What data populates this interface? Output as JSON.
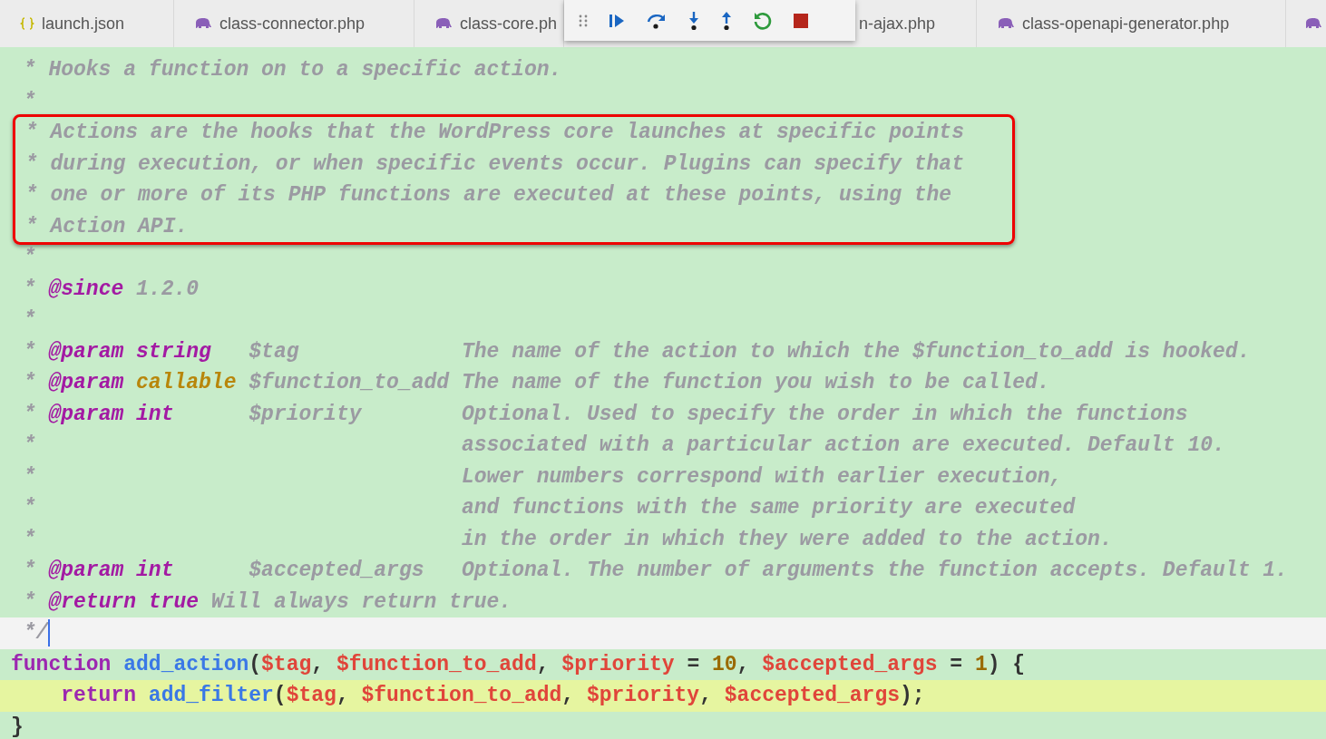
{
  "tabs": [
    {
      "label": "launch.json"
    },
    {
      "label": "class-connector.php"
    },
    {
      "label": "class-core.ph"
    },
    {
      "label": "n-ajax.php"
    },
    {
      "label": "class-openapi-generator.php"
    }
  ],
  "lines": [
    {
      "boxed": false,
      "current": false,
      "paused": false,
      "tokens": [
        {
          "kind": "comment",
          "text": " * Hooks a function on to a specific action."
        }
      ]
    },
    {
      "boxed": false,
      "current": false,
      "paused": false,
      "tokens": [
        {
          "kind": "comment",
          "text": " *"
        }
      ]
    },
    {
      "boxed": true,
      "current": false,
      "paused": false,
      "tokens": [
        {
          "kind": "comment",
          "text": " * Actions are the hooks that the WordPress core launches at specific points"
        }
      ]
    },
    {
      "boxed": true,
      "current": false,
      "paused": false,
      "tokens": [
        {
          "kind": "comment",
          "text": " * during execution, or when specific events occur. Plugins can specify that"
        }
      ]
    },
    {
      "boxed": true,
      "current": false,
      "paused": false,
      "tokens": [
        {
          "kind": "comment",
          "text": " * one or more of its PHP functions are executed at these points, using the"
        }
      ]
    },
    {
      "boxed": true,
      "current": false,
      "paused": false,
      "tokens": [
        {
          "kind": "comment",
          "text": " * Action API."
        }
      ]
    },
    {
      "boxed": false,
      "current": false,
      "paused": false,
      "tokens": [
        {
          "kind": "comment",
          "text": " *"
        }
      ]
    },
    {
      "boxed": false,
      "current": false,
      "paused": false,
      "tokens": [
        {
          "kind": "comment",
          "text": " * "
        },
        {
          "kind": "tag",
          "text": "@since"
        },
        {
          "kind": "comment",
          "text": " 1.2.0"
        }
      ]
    },
    {
      "boxed": false,
      "current": false,
      "paused": false,
      "tokens": [
        {
          "kind": "comment",
          "text": " *"
        }
      ]
    },
    {
      "boxed": false,
      "current": false,
      "paused": false,
      "tokens": [
        {
          "kind": "comment",
          "text": " * "
        },
        {
          "kind": "tag",
          "text": "@param"
        },
        {
          "kind": "tag",
          "text": " string"
        },
        {
          "kind": "comment",
          "text": "   $tag             The name of the action to which the $function_to_add is hooked."
        }
      ]
    },
    {
      "boxed": false,
      "current": false,
      "paused": false,
      "tokens": [
        {
          "kind": "comment",
          "text": " * "
        },
        {
          "kind": "tag",
          "text": "@param"
        },
        {
          "kind": "type",
          "text": " callable"
        },
        {
          "kind": "comment",
          "text": " $function_to_add The name of the function you wish to be called."
        }
      ]
    },
    {
      "boxed": false,
      "current": false,
      "paused": false,
      "tokens": [
        {
          "kind": "comment",
          "text": " * "
        },
        {
          "kind": "tag",
          "text": "@param"
        },
        {
          "kind": "tag",
          "text": " int"
        },
        {
          "kind": "comment",
          "text": "      $priority        Optional. Used to specify the order in which the functions"
        }
      ]
    },
    {
      "boxed": false,
      "current": false,
      "paused": false,
      "tokens": [
        {
          "kind": "comment",
          "text": " *                                  associated with a particular action are executed. Default 10."
        }
      ]
    },
    {
      "boxed": false,
      "current": false,
      "paused": false,
      "tokens": [
        {
          "kind": "comment",
          "text": " *                                  Lower numbers correspond with earlier execution,"
        }
      ]
    },
    {
      "boxed": false,
      "current": false,
      "paused": false,
      "tokens": [
        {
          "kind": "comment",
          "text": " *                                  and functions with the same priority are executed"
        }
      ]
    },
    {
      "boxed": false,
      "current": false,
      "paused": false,
      "tokens": [
        {
          "kind": "comment",
          "text": " *                                  in the order in which they were added to the action."
        }
      ]
    },
    {
      "boxed": false,
      "current": false,
      "paused": false,
      "tokens": [
        {
          "kind": "comment",
          "text": " * "
        },
        {
          "kind": "tag",
          "text": "@param"
        },
        {
          "kind": "tag",
          "text": " int"
        },
        {
          "kind": "comment",
          "text": "      $accepted_args   Optional. The number of arguments the function accepts. Default 1."
        }
      ]
    },
    {
      "boxed": false,
      "current": false,
      "paused": false,
      "tokens": [
        {
          "kind": "comment",
          "text": " * "
        },
        {
          "kind": "tag",
          "text": "@return"
        },
        {
          "kind": "tag",
          "text": " true"
        },
        {
          "kind": "comment",
          "text": " Will always return true."
        }
      ]
    },
    {
      "boxed": false,
      "current": true,
      "paused": false,
      "tokens": [
        {
          "kind": "comment",
          "text": " */"
        }
      ]
    },
    {
      "boxed": false,
      "current": false,
      "paused": false,
      "tokens": [
        {
          "kind": "keyword",
          "text": "function"
        },
        {
          "kind": "func",
          "text": " add_action"
        },
        {
          "kind": "plain",
          "text": "("
        },
        {
          "kind": "var",
          "text": "$tag"
        },
        {
          "kind": "plain",
          "text": ", "
        },
        {
          "kind": "var",
          "text": "$function_to_add"
        },
        {
          "kind": "plain",
          "text": ", "
        },
        {
          "kind": "var",
          "text": "$priority"
        },
        {
          "kind": "plain",
          "text": " = "
        },
        {
          "kind": "number",
          "text": "10"
        },
        {
          "kind": "plain",
          "text": ", "
        },
        {
          "kind": "var",
          "text": "$accepted_args"
        },
        {
          "kind": "plain",
          "text": " = "
        },
        {
          "kind": "number",
          "text": "1"
        },
        {
          "kind": "plain",
          "text": ") {"
        }
      ]
    },
    {
      "boxed": false,
      "current": false,
      "paused": true,
      "tokens": [
        {
          "kind": "keyword",
          "text": "    return"
        },
        {
          "kind": "func",
          "text": " add_filter"
        },
        {
          "kind": "plain",
          "text": "("
        },
        {
          "kind": "var",
          "text": "$tag"
        },
        {
          "kind": "plain",
          "text": ", "
        },
        {
          "kind": "var",
          "text": "$function_to_add"
        },
        {
          "kind": "plain",
          "text": ", "
        },
        {
          "kind": "var",
          "text": "$priority"
        },
        {
          "kind": "plain",
          "text": ", "
        },
        {
          "kind": "var",
          "text": "$accepted_args"
        },
        {
          "kind": "plain",
          "text": ");"
        }
      ]
    },
    {
      "boxed": false,
      "current": false,
      "paused": false,
      "tokens": [
        {
          "kind": "plain",
          "text": "}"
        }
      ]
    }
  ]
}
